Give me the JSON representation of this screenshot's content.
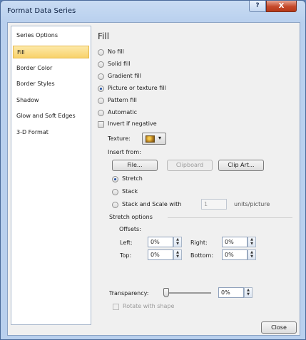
{
  "window": {
    "title": "Format Data Series",
    "help_label": "?",
    "close_label": "X"
  },
  "sidebar": {
    "items": [
      {
        "label": "Series Options",
        "active": false
      },
      {
        "label": "Fill",
        "active": true
      },
      {
        "label": "Border Color",
        "active": false
      },
      {
        "label": "Border Styles",
        "active": false
      },
      {
        "label": "Shadow",
        "active": false
      },
      {
        "label": "Glow and Soft Edges",
        "active": false
      },
      {
        "label": "3-D Format",
        "active": false
      }
    ]
  },
  "fill": {
    "heading": "Fill",
    "options": [
      {
        "label": "No fill",
        "selected": false
      },
      {
        "label": "Solid fill",
        "selected": false
      },
      {
        "label": "Gradient fill",
        "selected": false
      },
      {
        "label": "Picture or texture fill",
        "selected": true
      },
      {
        "label": "Pattern fill",
        "selected": false
      },
      {
        "label": "Automatic",
        "selected": false
      }
    ],
    "invert_if_negative": {
      "label": "Invert if negative",
      "checked": false
    },
    "texture_label": "Texture:",
    "insert_from_label": "Insert from:",
    "buttons": {
      "file": "File...",
      "clipboard": "Clipboard",
      "clip_art": "Clip Art..."
    },
    "stretch_label": "Stretch",
    "stack_label": "Stack",
    "stack_scale_label": "Stack and Scale with",
    "stack_scale_value": "1",
    "units_label": "units/picture",
    "stretch_options_label": "Stretch options",
    "offsets_label": "Offsets:",
    "offsets": {
      "left_label": "Left:",
      "left_value": "0%",
      "right_label": "Right:",
      "right_value": "0%",
      "top_label": "Top:",
      "top_value": "0%",
      "bottom_label": "Bottom:",
      "bottom_value": "0%"
    },
    "transparency_label": "Transparency:",
    "transparency_value": "0%",
    "transparency_fraction": 0,
    "rotate_with_shape": {
      "label": "Rotate with shape",
      "checked": false,
      "enabled": false
    }
  },
  "footer": {
    "close_label": "Close"
  }
}
